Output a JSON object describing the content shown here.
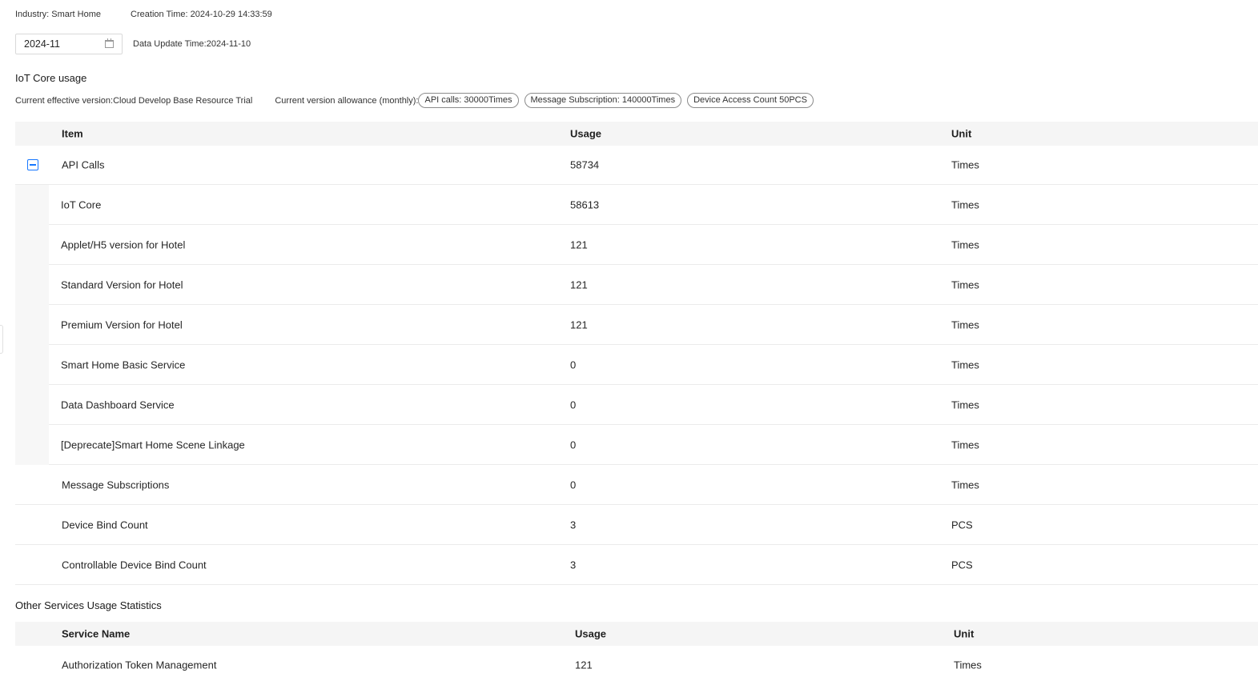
{
  "meta": {
    "industry": "Industry: Smart Home",
    "creation_time": "Creation Time: 2024-10-29 14:33:59"
  },
  "date_picker": {
    "value": "2024-11"
  },
  "update_time": "Data Update Time:2024-11-10",
  "iot_section": {
    "title": "IoT Core usage",
    "effective_version": "Current effective version:Cloud Develop Base Resource Trial",
    "allowance_label": "Current version allowance (monthly):",
    "tags": [
      "API calls: 30000Times",
      "Message Subscription: 140000Times",
      "Device Access Count 50PCS"
    ]
  },
  "iot_table": {
    "headers": {
      "item": "Item",
      "usage": "Usage",
      "unit": "Unit"
    },
    "parent": {
      "item": "API Calls",
      "usage": "58734",
      "unit": "Times"
    },
    "children": [
      {
        "item": "IoT Core",
        "usage": "58613",
        "unit": "Times"
      },
      {
        "item": "Applet/H5 version for Hotel",
        "usage": "121",
        "unit": "Times"
      },
      {
        "item": "Standard Version for Hotel",
        "usage": "121",
        "unit": "Times"
      },
      {
        "item": "Premium Version for Hotel",
        "usage": "121",
        "unit": "Times"
      },
      {
        "item": "Smart Home Basic Service",
        "usage": "0",
        "unit": "Times"
      },
      {
        "item": "Data Dashboard Service",
        "usage": "0",
        "unit": "Times"
      },
      {
        "item": "[Deprecate]Smart Home Scene Linkage",
        "usage": "0",
        "unit": "Times"
      }
    ],
    "rows": [
      {
        "item": "Message Subscriptions",
        "usage": "0",
        "unit": "Times"
      },
      {
        "item": "Device Bind Count",
        "usage": "3",
        "unit": "PCS"
      },
      {
        "item": "Controllable Device Bind Count",
        "usage": "3",
        "unit": "PCS"
      }
    ]
  },
  "other_section": {
    "title": "Other Services Usage Statistics"
  },
  "other_table": {
    "headers": {
      "item": "Service Name",
      "usage": "Usage",
      "unit": "Unit"
    },
    "rows": [
      {
        "item": "Authorization Token Management",
        "usage": "121",
        "unit": "Times"
      }
    ]
  }
}
